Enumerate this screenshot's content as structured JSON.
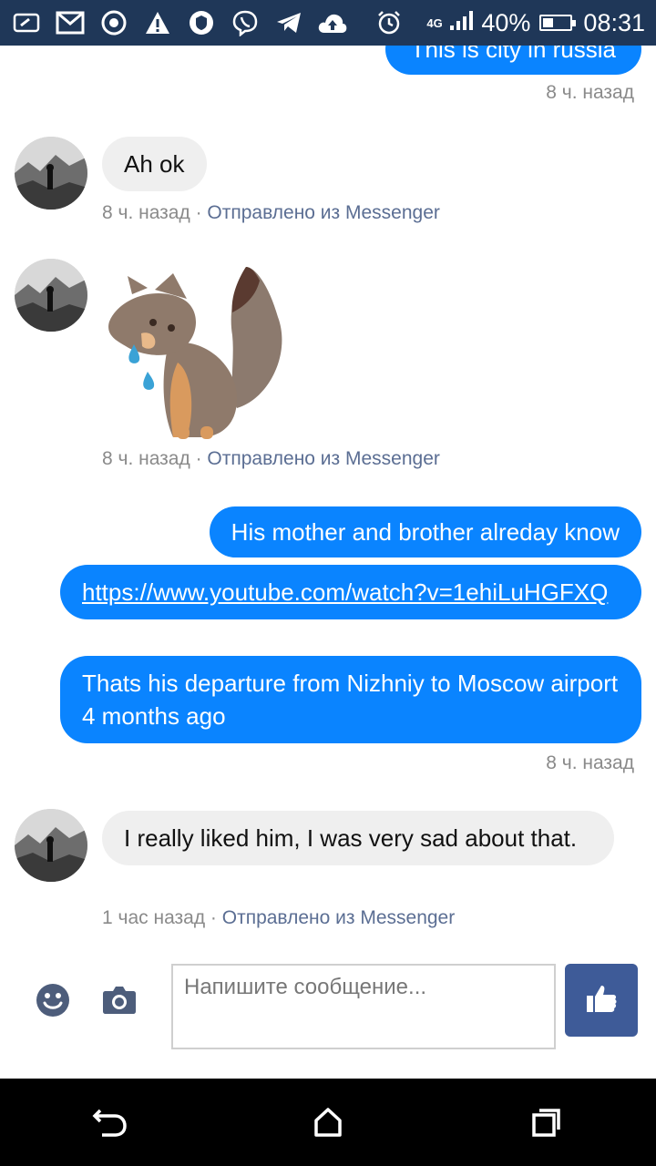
{
  "status_bar": {
    "battery_percent": "40%",
    "battery_level": 0.4,
    "time": "08:31",
    "network": "4G",
    "icons": [
      "screen-cast-icon",
      "gmail-icon",
      "chrome-icon",
      "warning-icon",
      "vpn-shield-icon",
      "viber-icon",
      "telegram-icon",
      "cloud-upload-icon",
      "alarm-icon"
    ]
  },
  "messages": {
    "top_partial": "This is city in russia",
    "ts1": "8 ч. назад",
    "m1": {
      "text": "Ah ok",
      "time": "8 ч. назад",
      "sep": " · ",
      "sent_via": "Отправлено из Messenger"
    },
    "m2": {
      "sticker": "crying-fox-sticker",
      "time": "8 ч. назад",
      "sep": " · ",
      "sent_via": "Отправлено из Messenger"
    },
    "out1": "His mother and brother alreday know",
    "out2_link": "https://www.youtube.com/watch?v=1ehiLuHGFXQ",
    "out3": "Thats his departure from Nizhniy to Moscow airport  4 months ago",
    "ts2": "8 ч. назад",
    "m3": {
      "text": "I really liked him, I was very sad about that.",
      "time": "1 час назад",
      "sep": " · ",
      "sent_via": "Отправлено из Messenger"
    }
  },
  "composer": {
    "placeholder": "Напишите сообщение...",
    "emoji_icon": "emoji-icon",
    "camera_icon": "camera-icon",
    "like_icon": "thumbs-up-icon"
  },
  "nav": {
    "back": "back-icon",
    "home": "home-icon",
    "recents": "recents-icon"
  },
  "colors": {
    "status_bar": "#1f3758",
    "bubble_out": "#0a84ff",
    "bubble_in": "#efefef",
    "like_button": "#3e5b98"
  }
}
